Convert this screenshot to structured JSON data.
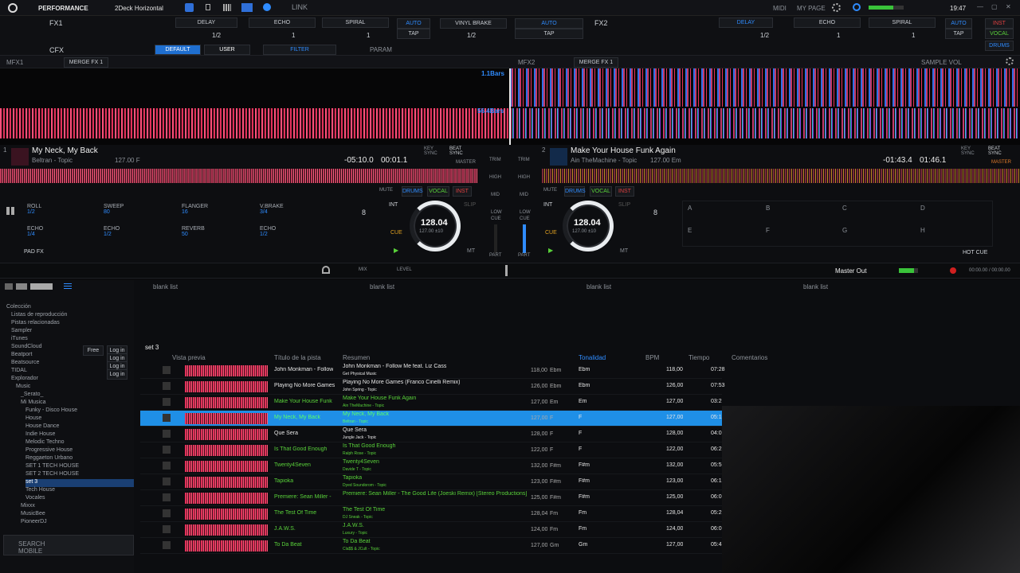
{
  "topbar": {
    "mode": "PERFORMANCE",
    "layout": "2Deck Horizontal",
    "link": "LINK",
    "midi": "MIDI",
    "mypage": "MY PAGE",
    "clock": "19:47"
  },
  "fx": {
    "fx1": "FX1",
    "fx2": "FX2",
    "cfx": "CFX",
    "left": [
      {
        "name": "DELAY",
        "val": "1/2"
      },
      {
        "name": "ECHO",
        "val": "1"
      },
      {
        "name": "SPIRAL",
        "val": "1"
      },
      {
        "name": "AUTO",
        "val": "TAP"
      }
    ],
    "right": [
      {
        "name": "DELAY",
        "val": "1/2"
      },
      {
        "name": "ECHO",
        "val": "1"
      },
      {
        "name": "SPIRAL",
        "val": "1"
      },
      {
        "name": "AUTO",
        "val": "TAP"
      }
    ],
    "vinyl_brake": "VINYL BRAKE",
    "vinyl_val": "1/2",
    "auto2": "AUTO",
    "tap2": "TAP",
    "cfx_default": "DEFAULT",
    "cfx_user": "USER",
    "cfx_filter": "FILTER",
    "param": "PARAM",
    "mfx1": "MFX1",
    "mfx2": "MFX2",
    "merge": "MERGE FX 1",
    "sample_vol": "SAMPLE VOL",
    "vocal": "VOCAL",
    "drums": "DRUMS",
    "inst": "INST"
  },
  "wave": {
    "bars1": "1.1Bars",
    "bars2": "56.4Bars"
  },
  "deck1": {
    "num": "1",
    "title": "My Neck, My Back",
    "artist": "Beltran - Topic",
    "bpm_key": "127.00  F",
    "remain": "-05:10.0",
    "elapsed": "00:01.1",
    "bpm": "128.04",
    "pitch": "127.00  ±10",
    "beat": "8",
    "key_sync": "KEY SYNC",
    "beat_sync": "BEAT SYNC",
    "master": "MASTER",
    "cue": "CUE",
    "int": "INT",
    "slip": "SLIP",
    "mt": "MT"
  },
  "deck2": {
    "num": "2",
    "title": "Make Your House Funk Again",
    "artist": "Ain TheMachine - Topic",
    "bpm_key": "127.00  Em",
    "remain": "-01:43.4",
    "elapsed": "01:46.1",
    "bpm": "128.04",
    "pitch": "127.00  ±10",
    "beat": "8",
    "key_sync": "KEY SYNC",
    "beat_sync": "BEAT SYNC",
    "master": "MASTER",
    "cue": "CUE",
    "int": "INT",
    "slip": "SLIP",
    "mt": "MT"
  },
  "mixer": {
    "trim": "TRIM",
    "high": "HIGH",
    "mid": "MID",
    "low": "LOW",
    "cue": "CUE",
    "part": "PART",
    "mute": "MUTE",
    "drums": "DRUMS",
    "vocal": "VOCAL",
    "inst": "INST"
  },
  "pads": [
    {
      "name": "ROLL",
      "val": "1/2"
    },
    {
      "name": "SWEEP",
      "val": "80"
    },
    {
      "name": "FLANGER",
      "val": "16"
    },
    {
      "name": "V.BRAKE",
      "val": "3/4"
    },
    {
      "name": "ECHO",
      "val": "1/4"
    },
    {
      "name": "ECHO",
      "val": "1/2"
    },
    {
      "name": "REVERB",
      "val": "50"
    },
    {
      "name": "ECHO",
      "val": "1/2"
    }
  ],
  "padfx": "PAD FX",
  "hotcue": "HOT CUE",
  "hotcue_letters": [
    "A",
    "B",
    "C",
    "D",
    "E",
    "F",
    "G",
    "H"
  ],
  "mixbar": {
    "mix": "MIX",
    "level": "LEVEL",
    "master_out": "Master Out",
    "time": "00:00.00 / 00:00.00"
  },
  "tree": [
    {
      "label": "Colección",
      "indent": 0
    },
    {
      "label": "Listas de reproducción",
      "indent": 1
    },
    {
      "label": "Pistas relacionadas",
      "indent": 1
    },
    {
      "label": "Sampler",
      "indent": 1
    },
    {
      "label": "iTunes",
      "indent": 1
    },
    {
      "label": "SoundCloud",
      "indent": 1
    },
    {
      "label": "Beatport",
      "indent": 1
    },
    {
      "label": "Beatsource",
      "indent": 1
    },
    {
      "label": "TIDAL",
      "indent": 1
    },
    {
      "label": "Explorador",
      "indent": 1
    },
    {
      "label": "Music",
      "indent": 2
    },
    {
      "label": "_Serato_",
      "indent": 3
    },
    {
      "label": "Mi Musica",
      "indent": 3
    },
    {
      "label": "Funky - Disco House",
      "indent": 4
    },
    {
      "label": "House",
      "indent": 4
    },
    {
      "label": "House Dance",
      "indent": 4
    },
    {
      "label": "Indie House",
      "indent": 4
    },
    {
      "label": "Melodic Techno",
      "indent": 4
    },
    {
      "label": "Progressive House",
      "indent": 4
    },
    {
      "label": "Reggaeton Urbano",
      "indent": 4
    },
    {
      "label": "SET 1 TECH HOUSE",
      "indent": 4
    },
    {
      "label": "SET 2 TECH HOUSE",
      "indent": 4
    },
    {
      "label": "set 3",
      "indent": 4
    },
    {
      "label": "Tech House",
      "indent": 4
    },
    {
      "label": "Vocales",
      "indent": 4
    },
    {
      "label": "Mixxx",
      "indent": 3
    },
    {
      "label": "MusicBee",
      "indent": 3
    },
    {
      "label": "PioneerDJ",
      "indent": 3
    }
  ],
  "login": {
    "free": "Free",
    "login": "Log in"
  },
  "search_mobile": "SEARCH MOBILE",
  "blanklists": [
    "blank list",
    "blank list",
    "blank list",
    "blank list"
  ],
  "list": {
    "title": "set 3",
    "headers": {
      "preview": "Vista previa",
      "track": "Título de la pista",
      "summary": "Resumen",
      "key": "Tonalidad",
      "bpm": "BPM",
      "time": "Tiempo",
      "comments": "Comentarios"
    },
    "rows": [
      {
        "track": "John Monkman - Follow",
        "sum1": "John Monkman - Follow Me feat. Liz Cass",
        "sum2": "Get Physical Music",
        "bpm_s": "118,00",
        "key_s": "Ebm",
        "key": "Ebm",
        "bpm": "118,00",
        "time": "07:28"
      },
      {
        "track": "Playing No More Games",
        "sum1": "Playing No More Games (Franco Cinelli Remix)",
        "sum2": "John Spring - Topic",
        "bpm_s": "126,00",
        "key_s": "Ebm",
        "key": "Ebm",
        "bpm": "126,00",
        "time": "07:53"
      },
      {
        "track": "Make Your House Funk",
        "sum1": "Make Your House Funk Again",
        "sum2": "Ain TheMachine - Topic",
        "bpm_s": "127,00",
        "key_s": "Em",
        "key": "Em",
        "bpm": "127,00",
        "time": "03:2"
      },
      {
        "track": "My Neck, My Back",
        "sum1": "My Neck, My Back",
        "sum2": "Beltran - Topic",
        "bpm_s": "127,00",
        "key_s": "F",
        "key": "F",
        "bpm": "127,00",
        "time": "05:1"
      },
      {
        "track": "Que Sera",
        "sum1": "Que Sera",
        "sum2": "Jungle Jack - Topic",
        "bpm_s": "128,00",
        "key_s": "F",
        "key": "F",
        "bpm": "128,00",
        "time": "04:0"
      },
      {
        "track": "Is That Good Enough",
        "sum1": "Is That Good Enough",
        "sum2": "Ralph Rose - Topic",
        "bpm_s": "122,00",
        "key_s": "F",
        "key": "F",
        "bpm": "122,00",
        "time": "06:2"
      },
      {
        "track": "Twenty4Seven",
        "sum1": "Twenty4Seven",
        "sum2": "Davide T - Topic",
        "bpm_s": "132,00",
        "key_s": "F#m",
        "key": "F#m",
        "bpm": "132,00",
        "time": "05:5"
      },
      {
        "track": "Tapioka",
        "sum1": "Tapioka",
        "sum2": "Dyed Soundorom - Topic",
        "bpm_s": "123,00",
        "key_s": "F#m",
        "key": "F#m",
        "bpm": "123,00",
        "time": "06:1"
      },
      {
        "track": "Premiere: Sean Miller -",
        "sum1": "Premiere: Sean Miller - The Good Life (Joeski Remix) [Stereo Productions]",
        "sum2": "",
        "bpm_s": "125,00",
        "key_s": "F#m",
        "key": "F#m",
        "bpm": "125,00",
        "time": "06:0"
      },
      {
        "track": "The Test Of Time",
        "sum1": "The Test Of Time",
        "sum2": "DJ Sneak - Topic",
        "bpm_s": "128,04",
        "key_s": "Fm",
        "key": "Fm",
        "bpm": "128,04",
        "time": "05:2"
      },
      {
        "track": "J.A.W.S.",
        "sum1": "J.A.W.S.",
        "sum2": "Luxury - Topic",
        "bpm_s": "124,00",
        "key_s": "Fm",
        "key": "Fm",
        "bpm": "124,00",
        "time": "06:0"
      },
      {
        "track": "To Da Beat",
        "sum1": "To Da Beat",
        "sum2": "Cla$$ & JCult - Topic",
        "bpm_s": "127,00",
        "key_s": "Gm",
        "key": "Gm",
        "bpm": "127,00",
        "time": "05:4"
      }
    ]
  },
  "colors": {
    "accent": "#1f8fe6",
    "green_text": "#59d13a",
    "pink_wave": "#e2315a",
    "blue_wave": "#2f8cff"
  }
}
